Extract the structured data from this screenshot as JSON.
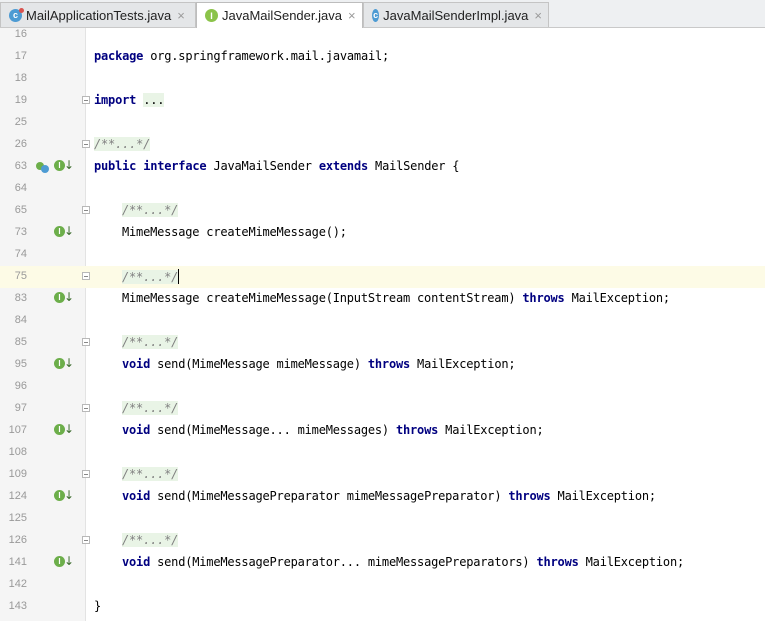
{
  "tabs": [
    {
      "label": "MailApplicationTests.java",
      "icon": "class-test-icon",
      "active": false
    },
    {
      "label": "JavaMailSender.java",
      "icon": "interface-icon",
      "active": true
    },
    {
      "label": "JavaMailSenderImpl.java",
      "icon": "class-icon",
      "active": false
    }
  ],
  "tab_close_glyph": "×",
  "gutter_icon_letters": {
    "interface": "I",
    "class": "c"
  },
  "lines": [
    {
      "num": "16"
    },
    {
      "num": "17",
      "indent": 0,
      "parts": [
        [
          "kw",
          "package"
        ],
        [
          "t",
          " org.springframework.mail.javamail;"
        ]
      ]
    },
    {
      "num": "18"
    },
    {
      "num": "19",
      "indent": 0,
      "fold": true,
      "parts": [
        [
          "kw",
          "import"
        ],
        [
          "t",
          " "
        ],
        [
          "fd",
          "..."
        ]
      ]
    },
    {
      "num": "25"
    },
    {
      "num": "26",
      "indent": 0,
      "fold": true,
      "parts": [
        [
          "cm",
          "/**...*/"
        ]
      ]
    },
    {
      "num": "63",
      "indent": 0,
      "gutter": "mix",
      "parts": [
        [
          "kw",
          "public"
        ],
        [
          "t",
          " "
        ],
        [
          "kw",
          "interface"
        ],
        [
          "t",
          " JavaMailSender "
        ],
        [
          "kw",
          "extends"
        ],
        [
          "t",
          " MailSender {"
        ]
      ]
    },
    {
      "num": "64"
    },
    {
      "num": "65",
      "indent": 1,
      "fold": true,
      "parts": [
        [
          "cm",
          "/**...*/"
        ]
      ]
    },
    {
      "num": "73",
      "indent": 1,
      "gutter": "impl",
      "parts": [
        [
          "t",
          "MimeMessage createMimeMessage();"
        ]
      ]
    },
    {
      "num": "74"
    },
    {
      "num": "75",
      "indent": 1,
      "fold": true,
      "current": true,
      "caret": true,
      "parts": [
        [
          "cm",
          "/**...*/"
        ]
      ]
    },
    {
      "num": "83",
      "indent": 1,
      "gutter": "impl",
      "parts": [
        [
          "t",
          "MimeMessage createMimeMessage(InputStream contentStream) "
        ],
        [
          "kw",
          "throws"
        ],
        [
          "t",
          " MailException;"
        ]
      ]
    },
    {
      "num": "84"
    },
    {
      "num": "85",
      "indent": 1,
      "fold": true,
      "parts": [
        [
          "cm",
          "/**...*/"
        ]
      ]
    },
    {
      "num": "95",
      "indent": 1,
      "gutter": "impl",
      "parts": [
        [
          "kw",
          "void"
        ],
        [
          "t",
          " send(MimeMessage mimeMessage) "
        ],
        [
          "kw",
          "throws"
        ],
        [
          "t",
          " MailException;"
        ]
      ]
    },
    {
      "num": "96"
    },
    {
      "num": "97",
      "indent": 1,
      "fold": true,
      "parts": [
        [
          "cm",
          "/**...*/"
        ]
      ]
    },
    {
      "num": "107",
      "indent": 1,
      "gutter": "impl",
      "parts": [
        [
          "kw",
          "void"
        ],
        [
          "t",
          " send(MimeMessage... mimeMessages) "
        ],
        [
          "kw",
          "throws"
        ],
        [
          "t",
          " MailException;"
        ]
      ]
    },
    {
      "num": "108"
    },
    {
      "num": "109",
      "indent": 1,
      "fold": true,
      "parts": [
        [
          "cm",
          "/**...*/"
        ]
      ]
    },
    {
      "num": "124",
      "indent": 1,
      "gutter": "impl",
      "parts": [
        [
          "kw",
          "void"
        ],
        [
          "t",
          " send(MimeMessagePreparator mimeMessagePreparator) "
        ],
        [
          "kw",
          "throws"
        ],
        [
          "t",
          " MailException;"
        ]
      ]
    },
    {
      "num": "125"
    },
    {
      "num": "126",
      "indent": 1,
      "fold": true,
      "parts": [
        [
          "cm",
          "/**...*/"
        ]
      ]
    },
    {
      "num": "141",
      "indent": 1,
      "gutter": "impl",
      "parts": [
        [
          "kw",
          "void"
        ],
        [
          "t",
          " send(MimeMessagePreparator... mimeMessagePreparators) "
        ],
        [
          "kw",
          "throws"
        ],
        [
          "t",
          " MailException;"
        ]
      ]
    },
    {
      "num": "142"
    },
    {
      "num": "143",
      "indent": 0,
      "parts": [
        [
          "t",
          "}"
        ]
      ]
    }
  ],
  "colors": {
    "keyword": "#000080",
    "comment": "#808080",
    "fold_bg": "#e9f4e6",
    "current_line": "#fdfbe6",
    "interface_icon": "#6cae4a",
    "class_icon": "#4d9bd3"
  }
}
